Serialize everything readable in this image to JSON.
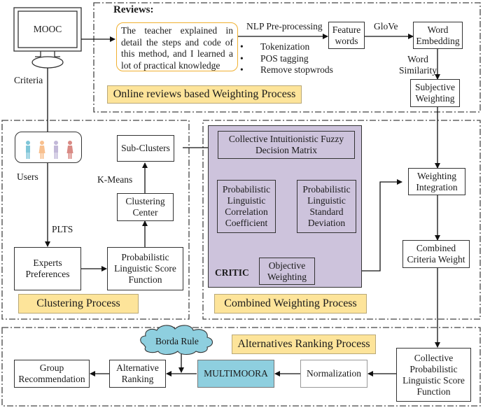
{
  "sources": {
    "mooc": "MOOC",
    "criteria_label": "Criteria",
    "users_label": "Users",
    "plts_label": "PLTS",
    "user_icons": [
      {
        "name": "user-icon-male-blue",
        "color": "#7fc6d8"
      },
      {
        "name": "user-icon-female-orange",
        "color": "#f8c08f"
      },
      {
        "name": "user-icon-male-purple",
        "color": "#c2b8d8"
      },
      {
        "name": "user-icon-female-red",
        "color": "#d98a84"
      }
    ]
  },
  "reviews_section": {
    "heading": "Reviews:",
    "review_text": "The teacher explained in detail the steps and code of this method, and I learned a lot of practical knowledge",
    "nlp_label": "NLP Pre-processing",
    "nlp_steps": [
      "Tokenization",
      "POS tagging",
      "Remove stopwrods"
    ],
    "feature_words": "Feature words",
    "glove_label": "GloVe",
    "word_embedding": "Word Embedding",
    "word_similarity": "Word Similarity",
    "subjective_weighting": "Subjective Weighting",
    "process_title": "Online reviews based Weighting Process"
  },
  "clustering_section": {
    "sub_clusters": "Sub-Clusters",
    "k_means_label": "K-Means",
    "clustering_center": "Clustering Center",
    "experts_preferences": "Experts Preferences",
    "pl_score_function": "Probabilistic Linguistic Score Function",
    "process_title": "Clustering Process"
  },
  "combined_section": {
    "decision_matrix": "Collective Intuitionistic Fuzzy Decision Matrix",
    "correlation": "Probabilistic Linguistic Correlation Coefficient",
    "std_dev": "Probabilistic Linguistic Standard Deviation",
    "objective_weighting": "Objective Weighting",
    "critic_label": "CRITIC",
    "weighting_integration": "Weighting Integration",
    "combined_criteria_weight": "Combined Criteria Weight",
    "process_title": "Combined Weighting Process"
  },
  "ranking_section": {
    "collective_score": "Collective Probabilistic Linguistic Score Function",
    "normalization": "Normalization",
    "multimoora": "MULTIMOORA",
    "borda_rule": "Borda Rule",
    "alternative_ranking": "Alternative Ranking",
    "group_recommendation": "Group Recommendation",
    "process_title": "Alternatives Ranking Process"
  },
  "colors": {
    "process_label_fill": "#fde49a",
    "critic_fill": "#cdc3dc",
    "multimoora_fill": "#8ecfdf",
    "cloud_fill": "#8ecfdf",
    "review_border": "#f0b030"
  }
}
